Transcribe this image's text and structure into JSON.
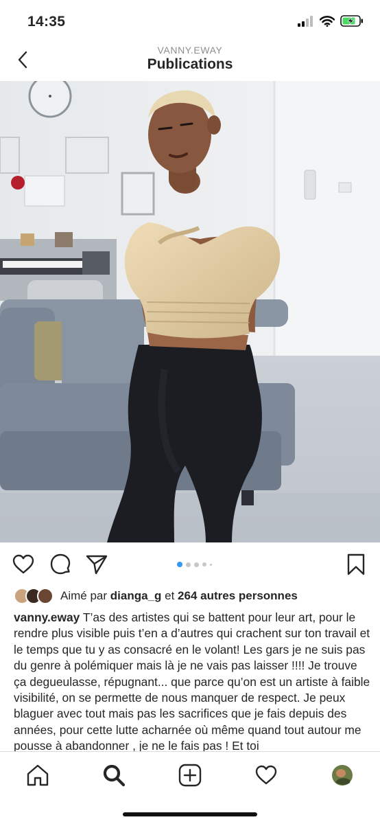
{
  "status_bar": {
    "time": "14:35"
  },
  "header": {
    "username": "VANNY.EWAY",
    "title": "Publications"
  },
  "carousel": {
    "pages": 5,
    "active": 1
  },
  "likes": {
    "prefix": "Aimé par",
    "liker": "dianga_g",
    "connector": "et",
    "others": "264 autres personnes"
  },
  "caption": {
    "username": "vanny.eway",
    "text": "T’as des artistes qui se battent pour leur art, pour le rendre plus visible puis t’en a d’autres qui crachent sur ton travail et le temps que tu y as consacré en le volant! Les gars je ne suis pas du genre à polémiquer mais là je ne vais pas laisser !!!! Je trouve ça degueulasse, répugnant... que parce qu’on est un artiste à faible visibilité, on se permette de nous manquer de respect. Je peux blaguer avec tout mais pas les sacrifices que je fais depuis des années, pour cette lutte acharnée où même quand tout autour me pousse à abandonner , je ne le fais pas ! Et toi"
  },
  "tab_bar": {
    "items": [
      "home-icon",
      "search-icon",
      "new-post-icon",
      "activity-icon",
      "profile-avatar"
    ],
    "active": "search-icon"
  },
  "colors": {
    "text": "#262626",
    "secondary": "#8e8e8e",
    "accent_blue": "#3897f0",
    "battery_green": "#4cd964"
  }
}
